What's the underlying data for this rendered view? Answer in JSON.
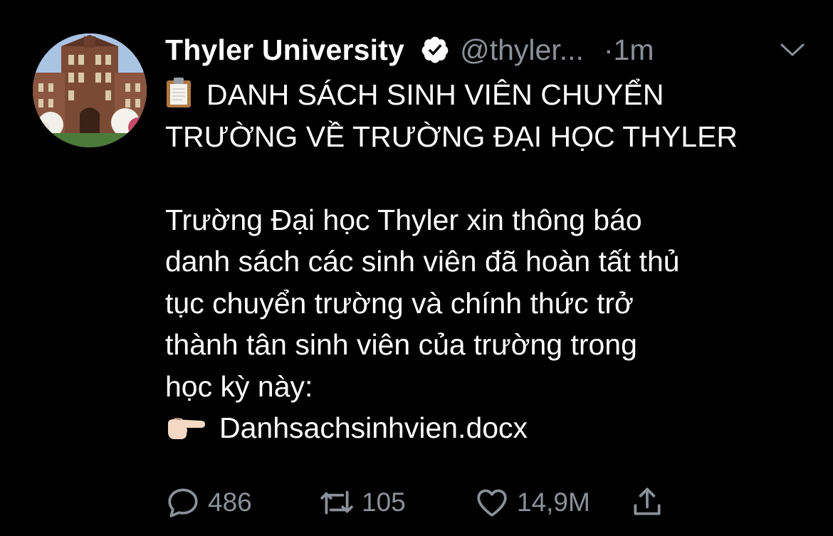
{
  "tweet": {
    "author_name": "Thyler University",
    "handle": "@thyler...",
    "time": "·1m",
    "title_lines": [
      "DANH SÁCH SINH VIÊN CHUYỂN",
      "TRƯỜNG VỀ TRƯỜNG ĐẠI HỌC THYLER"
    ],
    "body_lines": [
      "Trường Đại học Thyler xin thông báo",
      "danh sách các sinh viên đã hoàn tất thủ",
      "tục chuyển trường và chính thức trở",
      "thành tân sinh viên của trường trong",
      "học kỳ này:"
    ],
    "attachment": "Danhsachsinhvien.docx",
    "title_emoji": "clipboard-icon",
    "attachment_emoji": "pointing-hand-icon"
  },
  "actions": {
    "replies": "486",
    "retweets": "105",
    "likes": "14,9M"
  },
  "colors": {
    "background": "#000000",
    "text": "#ffffff",
    "secondary": "#8b9199"
  }
}
